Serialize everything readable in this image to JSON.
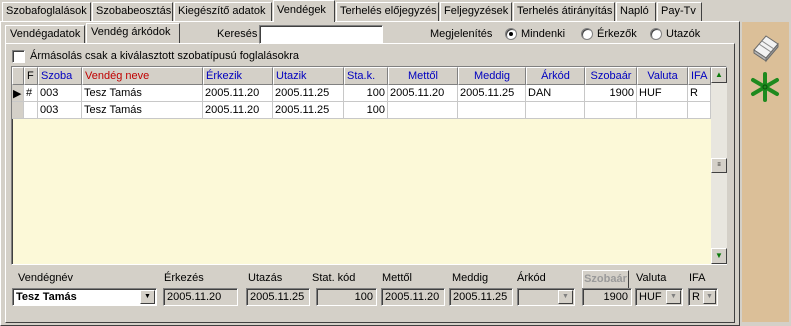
{
  "top_tabs": [
    {
      "label": "Szobafoglalások"
    },
    {
      "label": "Szobabeosztás"
    },
    {
      "label": "Kiegészítő adatok"
    },
    {
      "label": "Vendégek"
    },
    {
      "label": "Terhelés előjegyzés"
    },
    {
      "label": "Feljegyzések"
    },
    {
      "label": "Terhelés átirányítás"
    },
    {
      "label": "Napló"
    },
    {
      "label": "Pay-Tv"
    }
  ],
  "sub_tabs": [
    {
      "label": "Vendégadatok"
    },
    {
      "label": "Vendég árkódok"
    }
  ],
  "search": {
    "label": "Keresés",
    "value": ""
  },
  "display": {
    "label": "Megjelenítés",
    "options": [
      "Mindenki",
      "Érkezők",
      "Utazók"
    ],
    "selected": "Mindenki"
  },
  "copy_checkbox": {
    "label": "Ármásolás csak a kiválasztott szobatípusú foglalásokra",
    "checked": false
  },
  "grid": {
    "columns": [
      "F",
      "Szoba",
      "Vendég neve",
      "Érkezik",
      "Utazik",
      "Sta.k.",
      "Mettől",
      "Meddig",
      "Árkód",
      "Szobaár",
      "Valuta",
      "IFA"
    ],
    "rows": [
      {
        "indicator": "▶",
        "f": "#",
        "szoba": "003",
        "nev": "Tesz Tamás",
        "erkezik": "2005.11.20",
        "utazik": "2005.11.25",
        "stak": "100",
        "mettol": "2005.11.20",
        "meddig": "2005.11.25",
        "arkod": "DAN",
        "szobaar": "1900",
        "valuta": "HUF",
        "ifa": "R"
      },
      {
        "indicator": "",
        "f": "",
        "szoba": "003",
        "nev": "Tesz Tamás",
        "erkezik": "2005.11.20",
        "utazik": "2005.11.25",
        "stak": "100",
        "mettol": "",
        "meddig": "",
        "arkod": "",
        "szobaar": "",
        "valuta": "",
        "ifa": ""
      }
    ]
  },
  "detail": {
    "vendegnev_label": "Vendégnév",
    "vendegnev_value": "Tesz Tamás",
    "erkezes_label": "Érkezés",
    "erkezes_value": "2005.11.20",
    "utazas_label": "Utazás",
    "utazas_value": "2005.11.25",
    "statkod_label": "Stat. kód",
    "statkod_value": "100",
    "mettol_label": "Mettől",
    "mettol_value": "2005.11.20",
    "meddig_label": "Meddig",
    "meddig_value": "2005.11.25",
    "arkod_label": "Árkód",
    "arkod_value": "",
    "szobaar_button": "Szobaár",
    "szobaar_value": "1900",
    "valuta_label": "Valuta",
    "valuta_value": "HUF",
    "ifa_label": "IFA",
    "ifa_value": "R"
  },
  "icons": {
    "toolbar_top": "eraser-icon",
    "toolbar_second": "asterisk-icon"
  },
  "colors": {
    "grid_bg": "#fcf9d8",
    "header_blue": "#0000c0",
    "header_red": "#c00000",
    "toolbar_bg": "#dbbf98",
    "asterisk_green": "#1e8a1e"
  }
}
